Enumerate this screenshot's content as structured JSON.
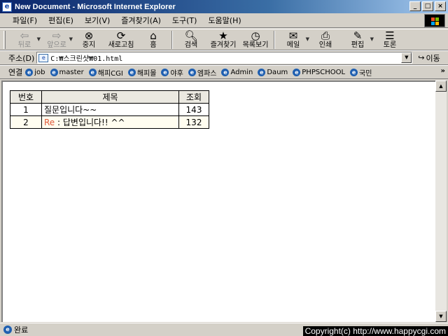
{
  "window": {
    "title": "New Document - Microsoft Internet Explorer",
    "controls": [
      "_",
      "□",
      "×"
    ]
  },
  "menu": [
    "파일(F)",
    "편집(E)",
    "보기(V)",
    "즐겨찾기(A)",
    "도구(T)",
    "도움말(H)"
  ],
  "toolbar": {
    "back": "뒤로",
    "forward": "앞으로",
    "stop": "중지",
    "refresh": "새로고침",
    "home": "홈",
    "search": "검색",
    "favorites": "즐겨찾기",
    "history": "목록보기",
    "mail": "메일",
    "print": "인쇄",
    "edit": "편집",
    "discuss": "토론"
  },
  "address": {
    "label": "주소(D)",
    "value": "C:₩스크린샷₩01.html",
    "go": "이동"
  },
  "links": {
    "label": "연결",
    "items": [
      "job",
      "master",
      "해피CGI",
      "해피몰",
      "야후",
      "엠파스",
      "Admin",
      "Daum",
      "PHPSCHOOL",
      "국민"
    ]
  },
  "board": {
    "headers": {
      "num": "번호",
      "title": "제목",
      "views": "조회"
    },
    "rows": [
      {
        "num": "1",
        "prefix": "",
        "title": "질문입니다~~",
        "views": "143"
      },
      {
        "num": "2",
        "prefix": "Re",
        "title": " : 답변입니다!! ^^",
        "views": "132"
      }
    ]
  },
  "status": {
    "text": "완료",
    "copyright": "Copyright(c) http://www.happycgi.com"
  },
  "colors": {
    "titlebar_start": "#0a246a",
    "reply_prefix": "#e05a3a",
    "header_bg": "#ebe9e1"
  }
}
